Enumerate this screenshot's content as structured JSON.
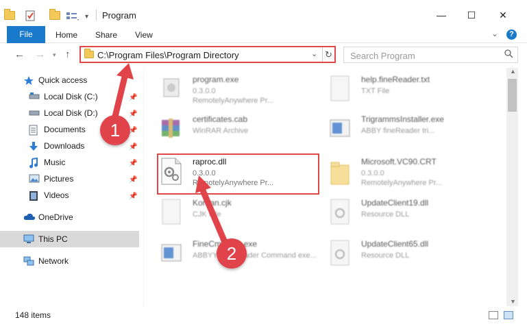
{
  "window": {
    "title": "Program",
    "minimize": "—",
    "maximize": "☐",
    "close": "✕"
  },
  "ribbon": {
    "file": "File",
    "tabs": [
      "Home",
      "Share",
      "View"
    ],
    "help": "?"
  },
  "nav": {
    "address": "C:\\Program Files\\Program Directory",
    "search_placeholder": "Search Program"
  },
  "sidebar": {
    "items": [
      {
        "label": "Quick access",
        "icon": "star-icon",
        "pinned": false
      },
      {
        "label": "Local Disk (C:)",
        "icon": "drive-icon",
        "pinned": true
      },
      {
        "label": "Local Disk (D:)",
        "icon": "drive-icon",
        "pinned": true
      },
      {
        "label": "Documents",
        "icon": "documents-icon",
        "pinned": true
      },
      {
        "label": "Downloads",
        "icon": "downloads-icon",
        "pinned": true
      },
      {
        "label": "Music",
        "icon": "music-icon",
        "pinned": true
      },
      {
        "label": "Pictures",
        "icon": "pictures-icon",
        "pinned": true
      },
      {
        "label": "Videos",
        "icon": "videos-icon",
        "pinned": true
      },
      {
        "label": "OneDrive",
        "icon": "onedrive-icon",
        "pinned": false
      },
      {
        "label": "This PC",
        "icon": "this-pc-icon",
        "pinned": false
      },
      {
        "label": "Network",
        "icon": "network-icon",
        "pinned": false
      }
    ]
  },
  "files": [
    {
      "name": "program.exe",
      "meta": "0.3.0.0",
      "meta2": "RemotelyAnywhere Pr...",
      "icon": "exe-icon"
    },
    {
      "name": "help.fineReader.txt",
      "meta": "TXT File",
      "meta2": "",
      "icon": "txt-icon"
    },
    {
      "name": "certificates.cab",
      "meta": "WinRAR Archive",
      "meta2": "",
      "icon": "winrar-icon"
    },
    {
      "name": "TrigrammsInstaller.exe",
      "meta": "ABBY fineReader tri...",
      "meta2": "",
      "icon": "exe-icon"
    },
    {
      "name": "raproc.dll",
      "meta": "0.3.0.0",
      "meta2": "RemotelyAnywhere Pr...",
      "icon": "dll-icon"
    },
    {
      "name": "Microsoft.VC90.CRT",
      "meta": "0.3.0.0",
      "meta2": "RemotelyAnywhere Pr...",
      "icon": "folder-icon"
    },
    {
      "name": "Korean.cjk",
      "meta": "CJK File",
      "meta2": "",
      "icon": "file-icon"
    },
    {
      "name": "UpdateClient19.dll",
      "meta": "Resource DLL",
      "meta2": "",
      "icon": "dll-icon"
    },
    {
      "name": "FineCmdLine.exe",
      "meta": "ABBYY FineReader Command exe...",
      "meta2": "",
      "icon": "exe-icon"
    },
    {
      "name": "UpdateClient65.dll",
      "meta": "Resource DLL",
      "meta2": "",
      "icon": "dll-icon"
    }
  ],
  "status": {
    "items": "148 items"
  },
  "annotations": {
    "step1": "1",
    "step2": "2",
    "color": "#e0444a"
  }
}
